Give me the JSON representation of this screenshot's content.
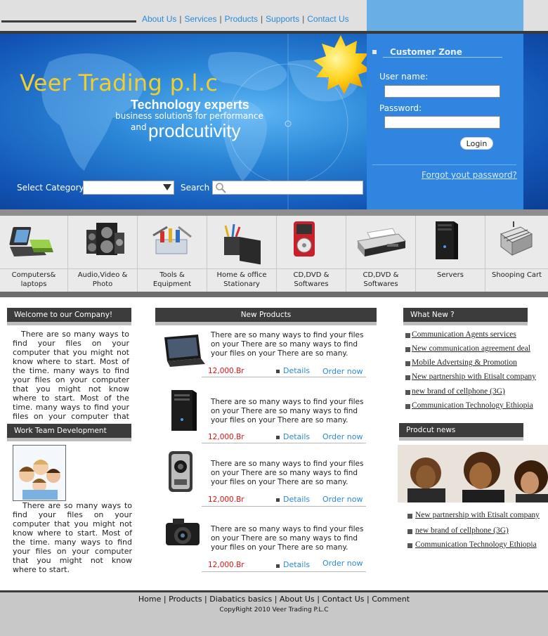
{
  "top_nav": [
    "About Us",
    "Services",
    "Products",
    "Supports",
    "Contact Us"
  ],
  "banner": {
    "logo": "Veer Trading p.l.c",
    "tagline_title": "Technology experts",
    "tagline_sub": "business solutions for performance",
    "tagline_and": "and",
    "tagline_big": "prodcutivity",
    "select_category_label": "Select Category",
    "search_label": "Search"
  },
  "customer_zone": {
    "title": "Customer Zone",
    "username_label": "User name:",
    "password_label": "Password:",
    "login_label": "Login",
    "forgot_label": "Forgot yout password?"
  },
  "categories": [
    {
      "l1": "Computers&",
      "l2": "laptops",
      "icon": "laptop-icon"
    },
    {
      "l1": "Audio,Video &",
      "l2": "Photo",
      "icon": "speaker-icon"
    },
    {
      "l1": "Tools &",
      "l2": "Equipment",
      "icon": "toolbox-icon"
    },
    {
      "l1": "Home & office",
      "l2": "Stationary",
      "icon": "stationery-icon"
    },
    {
      "l1": "CD,DVD &",
      "l2": "Softwares",
      "icon": "media-player-icon"
    },
    {
      "l1": "CD,DVD &",
      "l2": "Softwares",
      "icon": "printer-icon"
    },
    {
      "l1": "Servers",
      "l2": "",
      "icon": "server-icon"
    },
    {
      "l1": "Shooping Cart",
      "l2": "",
      "icon": "cart-icon"
    }
  ],
  "left": {
    "welcome_title": "Welcome to our Company!",
    "welcome_text": "There are so many ways to find your files on your computer that you might not know where to start. Most of the time. many ways to find your files on your computer that you might not know where to start. Most of the time. many ways to find your files on your computer that you.",
    "work_title": "Work Team Development",
    "work_text": "There are so many ways to find your files on your computer that you might not know where to start. Most of the time. many ways to find your files on your computer that you might not know where to start."
  },
  "products": {
    "title": "New Products",
    "items": [
      {
        "text": "There are so many ways to find your files on your There are so many ways to find your files on your There are so many.",
        "price": "12,000.Br",
        "details": "Details",
        "order": "Order now",
        "icon": "tablet-icon"
      },
      {
        "text": "There are so many ways to find your files on your There are so many ways to find your files on your There are so many.",
        "price": "12,000.Br",
        "details": "Details",
        "order": "Order now",
        "icon": "server-tower-icon"
      },
      {
        "text": "There are so many ways to find your files on your There are so many ways to find your files on your There are so many.",
        "price": "12,000.Br",
        "details": "Details",
        "order": "Order now",
        "icon": "projector-icon"
      },
      {
        "text": "There are so many ways to find your files on your There are so many ways to find your files on your There are so many.",
        "price": "12,000.Br",
        "details": "Details",
        "order": "Order now",
        "icon": "camera-icon"
      }
    ]
  },
  "whats_new": {
    "title": "What New ?",
    "items": [
      "Communication Agents services",
      "New communication agreement deal",
      "Mobile Advertsing & Promotion",
      "New partnership with Etisalt company",
      "new brand of cellphone (3G)",
      "Communication Technology Ethiopia"
    ]
  },
  "product_news": {
    "title": "Prodcut news",
    "items": [
      "New partnership with Etisalt company",
      "new brand of cellphone (3G)",
      "Communication Technology Ethiopia"
    ]
  },
  "footer": {
    "links": [
      "Home",
      "Products",
      "Diabatics basics",
      "About Us",
      "Contact Us",
      "Comment"
    ],
    "copyright": "CopyRight 2010 Veer Trading P.L.C"
  },
  "colors": {
    "accent_blue": "#2a8ad8",
    "logo_yellow": "#f3cd2b",
    "price_red": "#e01010",
    "header_dark": "#3c3c3c"
  }
}
